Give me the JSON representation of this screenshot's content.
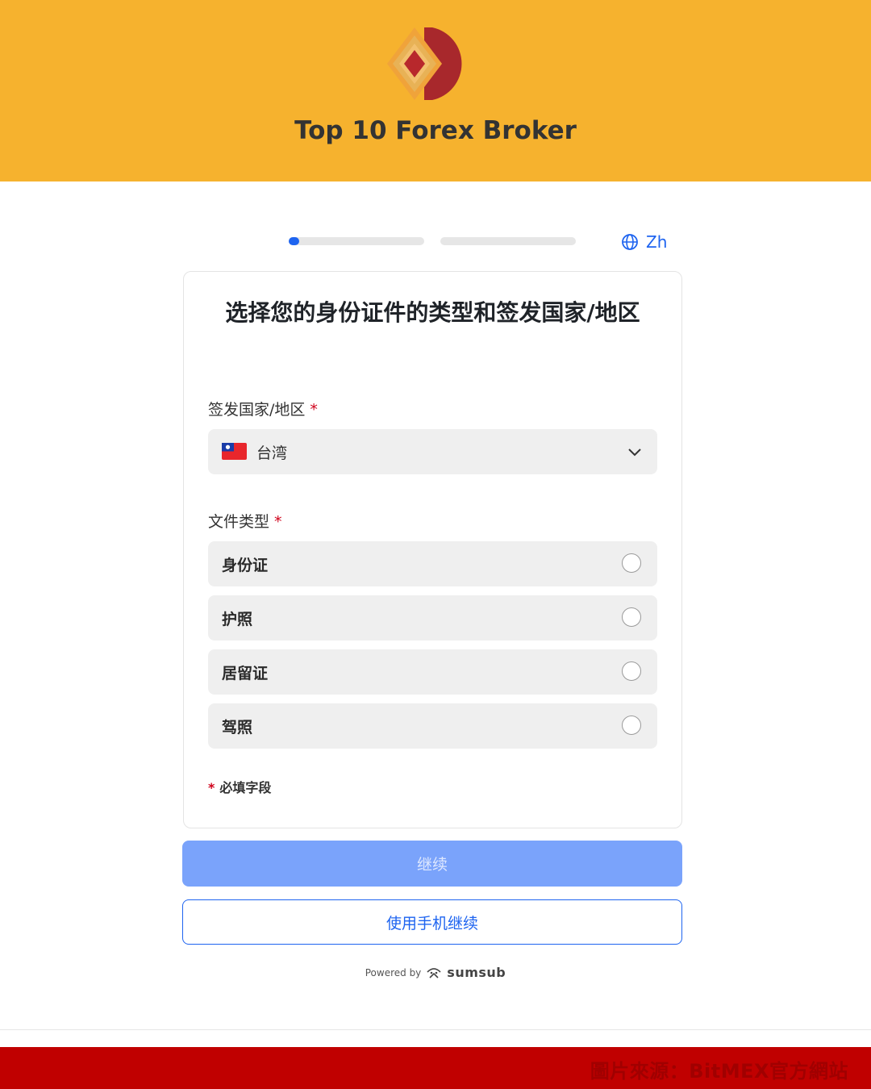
{
  "header": {
    "brand_title": "Top 10 Forex Broker",
    "background_color": "#f6b22e",
    "logo_icon": "double-diamond-logo"
  },
  "progress": {
    "steps": [
      {
        "fill_fraction": 0.08
      },
      {
        "fill_fraction": 0.0
      }
    ],
    "accent_color": "#1e64f0"
  },
  "language": {
    "icon": "globe-icon",
    "label": "Zh"
  },
  "form": {
    "title": "选择您的身份证件的类型和签发国家/地区",
    "country": {
      "label": "签发国家/地区",
      "required_mark": "*",
      "selected_value": "台湾",
      "flag_icon": "taiwan-flag-icon"
    },
    "doc_type": {
      "label": "文件类型",
      "required_mark": "*",
      "options": [
        {
          "label": "身份证",
          "checked": false
        },
        {
          "label": "护照",
          "checked": false
        },
        {
          "label": "居留证",
          "checked": false
        },
        {
          "label": "驾照",
          "checked": false
        }
      ]
    },
    "required_note": {
      "star": "*",
      "text": "必填字段"
    }
  },
  "actions": {
    "continue_label": "继续",
    "continue_disabled": true,
    "phone_label": "使用手机继续"
  },
  "footer": {
    "powered_by": "Powered by",
    "brand": "sumsub"
  },
  "source_banner": {
    "text": "圖片來源：BitMEX官方網站",
    "background_color": "#c00000"
  }
}
